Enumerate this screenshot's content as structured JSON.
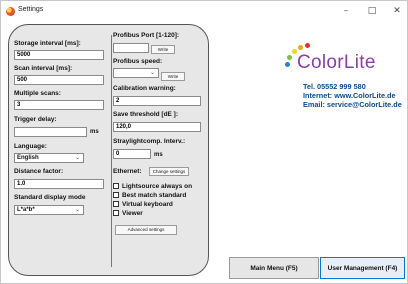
{
  "window": {
    "title": "Settings",
    "minimize": "–",
    "maximize": "□",
    "close": "✕"
  },
  "left_column": {
    "storage_interval": {
      "label": "Storage interval [ms]:",
      "value": "5000"
    },
    "scan_interval": {
      "label": "Scan interval [ms]:",
      "value": "500"
    },
    "multiple_scans": {
      "label": "Multiple scans:",
      "value": "3"
    },
    "trigger_delay": {
      "label": "Trigger delay:",
      "value": "",
      "unit": "ms"
    },
    "language": {
      "label": "Language:",
      "value": "English"
    },
    "distance_factor": {
      "label": "Distance factor:",
      "value": "1.0"
    },
    "standard_display_mode": {
      "label": "Standard display mode",
      "value": "L*a*b*"
    }
  },
  "right_column": {
    "profibus_port": {
      "label": "Profibus Port [1-120]:",
      "value": "",
      "button": "Write"
    },
    "profibus_speed": {
      "label": "Profibus speed:",
      "value": "",
      "button": "Write"
    },
    "calibration_warning": {
      "label": "Calibration warning:",
      "value": "2"
    },
    "save_threshold": {
      "label": "Save threshold [dE ]:",
      "value": "120,0"
    },
    "straylight": {
      "label": "Straylightcomp. Interv.:",
      "value": "0",
      "unit": "ms"
    },
    "ethernet": {
      "label": "Ethernet:",
      "button": "Change settings"
    },
    "checkboxes": [
      {
        "label": "Lightsource always on",
        "checked": false
      },
      {
        "label": "Best match standard",
        "checked": false
      },
      {
        "label": "Virtual keyboard",
        "checked": false
      },
      {
        "label": "Viewer",
        "checked": false
      }
    ],
    "advanced_button": "Advanced settings"
  },
  "branding": {
    "logo_text": "ColorLite",
    "phone": "Tel. 05552 999 580",
    "internet": "Internet: www.ColorLite.de",
    "email": "Email: service@ColorLite.de"
  },
  "footer": {
    "main_menu": "Main Menu (F5)",
    "user_management": "User Management (F4)"
  },
  "colors": {
    "logo_purple": "#8a3fa8",
    "contact_blue": "#0a4a8a",
    "focus_blue": "#0078d7"
  }
}
